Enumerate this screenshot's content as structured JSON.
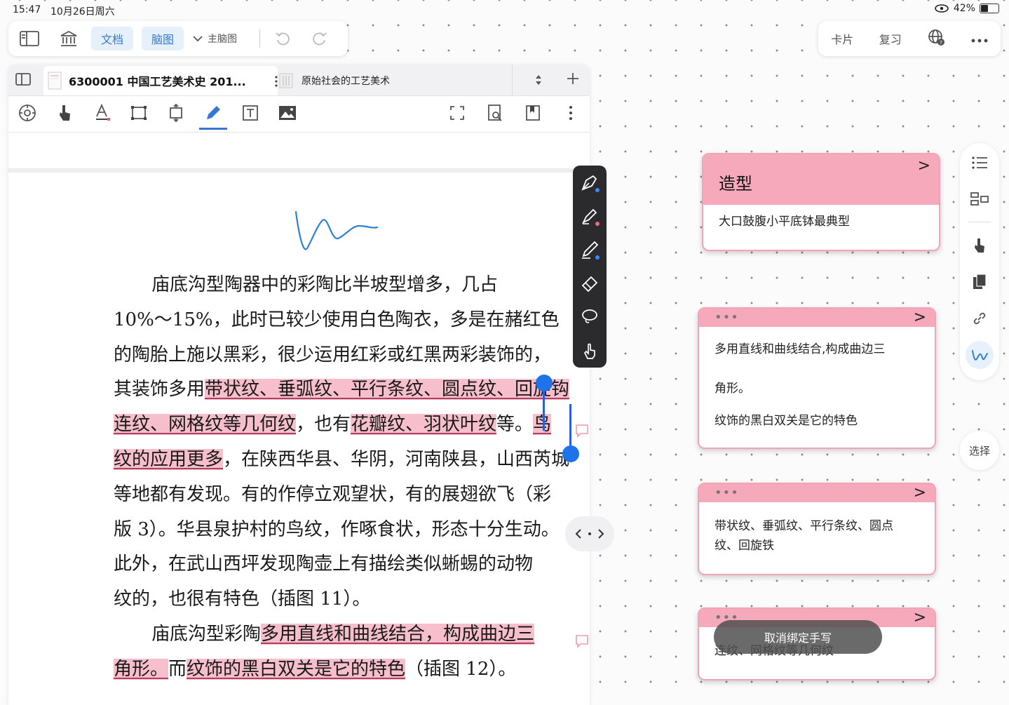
{
  "status_bar": {
    "time": "15:47",
    "date": "10月26日周六",
    "battery": "42%",
    "battery_level": 0.42
  },
  "top_left_toolbar": {
    "doc_tab": "文档",
    "mindmap_tab": "脑图",
    "main_map": "主脑图"
  },
  "top_right_toolbar": {
    "cards": "卡片",
    "review": "复习"
  },
  "doc_tabs": [
    {
      "title": "6300001 中国工艺美术史 201..."
    },
    {
      "title": "原始社会的工艺美术"
    }
  ],
  "doc_text": {
    "p1_l1": "庙底沟型陶器中的彩陶比半坡型增多，几占",
    "p1_l2": "10%～15%，此时已较少使用白色陶衣，多是在赭红色",
    "p1_l3": "的陶胎上施以黑彩，很少运用红彩或红黑两彩装饰的，",
    "p1_l4a": "其装饰多用",
    "p1_l4b": "带状纹、垂弧纹、平行条纹、圆点纹、回旋钩",
    "p1_l5a": "连纹、网格纹等几何纹",
    "p1_l5b": "，也有",
    "p1_l5c": "花瓣纹、羽状叶纹",
    "p1_l5d": "等。",
    "p1_l5e": "鸟",
    "p1_l6a": "纹的应用更多",
    "p1_l6b": "，在陕西华县、华阴，河南陕县，山西芮城",
    "p1_l7": "等地都有发现。有的作停立观望状，有的展翅欲飞（彩",
    "p1_l8": "版 3）。华县泉护村的鸟纹，作啄食状，形态十分生动。",
    "p1_l9": "此外，在武山西坪发现陶壶上有描绘类似蜥蜴的动物",
    "p1_l10": "纹的，也很有特色（插图 11）。",
    "p2_l1a": "庙底沟型彩陶",
    "p2_l1b": "多用直线和曲线结合，构成曲边三",
    "p2_l2a": "角形。",
    "p2_l2b": "而",
    "p2_l2c": "纹饰的黑白双关是它的特色",
    "p2_l2d": "（插图 12）。"
  },
  "cards": [
    {
      "title": "造型",
      "body": "大口鼓腹小平底钵最典型"
    },
    {
      "lines": [
        "多用直线和曲线结合,构成曲边三",
        "角形。",
        "纹饰的黑白双关是它的特色"
      ]
    },
    {
      "lines": [
        "带状纹、垂弧纹、平行条纹、圆点",
        "纹、回旋铁"
      ]
    },
    {
      "lines": [
        "连纹、网格纹等几何纹"
      ]
    }
  ],
  "rail": {
    "select_label": "选择"
  },
  "toast": "取消绑定手写",
  "colors": {
    "accent": "#3478d4",
    "highlight": "#f7bfcc",
    "card_head": "#f6a9ba",
    "palette_bg": "#2b2b2d"
  }
}
